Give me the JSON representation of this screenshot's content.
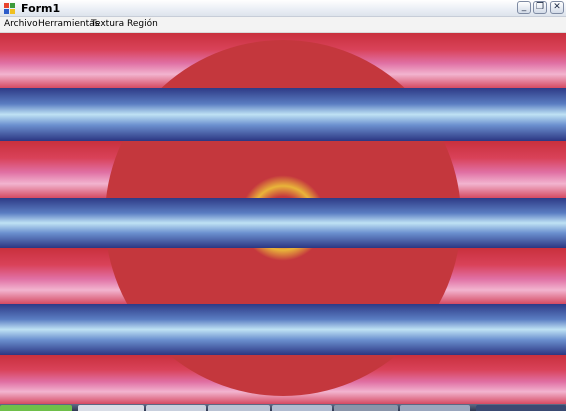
{
  "window": {
    "title": "Form1",
    "controls": {
      "minimize_icon": "minimize-icon",
      "restore_icon": "restore-icon",
      "close_icon": "close-icon"
    }
  },
  "menu": {
    "items": [
      {
        "label": "Archivo"
      },
      {
        "label": "Herramientas"
      },
      {
        "label": "Textura"
      },
      {
        "label": "Región"
      }
    ]
  },
  "canvas": {
    "circle_fill": "#c4373d",
    "ring_colors": [
      "#c4373d",
      "#e9b43a"
    ],
    "stripe_colors": {
      "blue_band": [
        "#303c86",
        "#7aa6d8",
        "#b8dcf0"
      ],
      "red_band": [
        "#d63c4a",
        "#e06a9a",
        "#f0b0cc"
      ]
    }
  },
  "taskbar": {
    "colors": [
      "#5f6c87",
      "#2e3852"
    ]
  }
}
